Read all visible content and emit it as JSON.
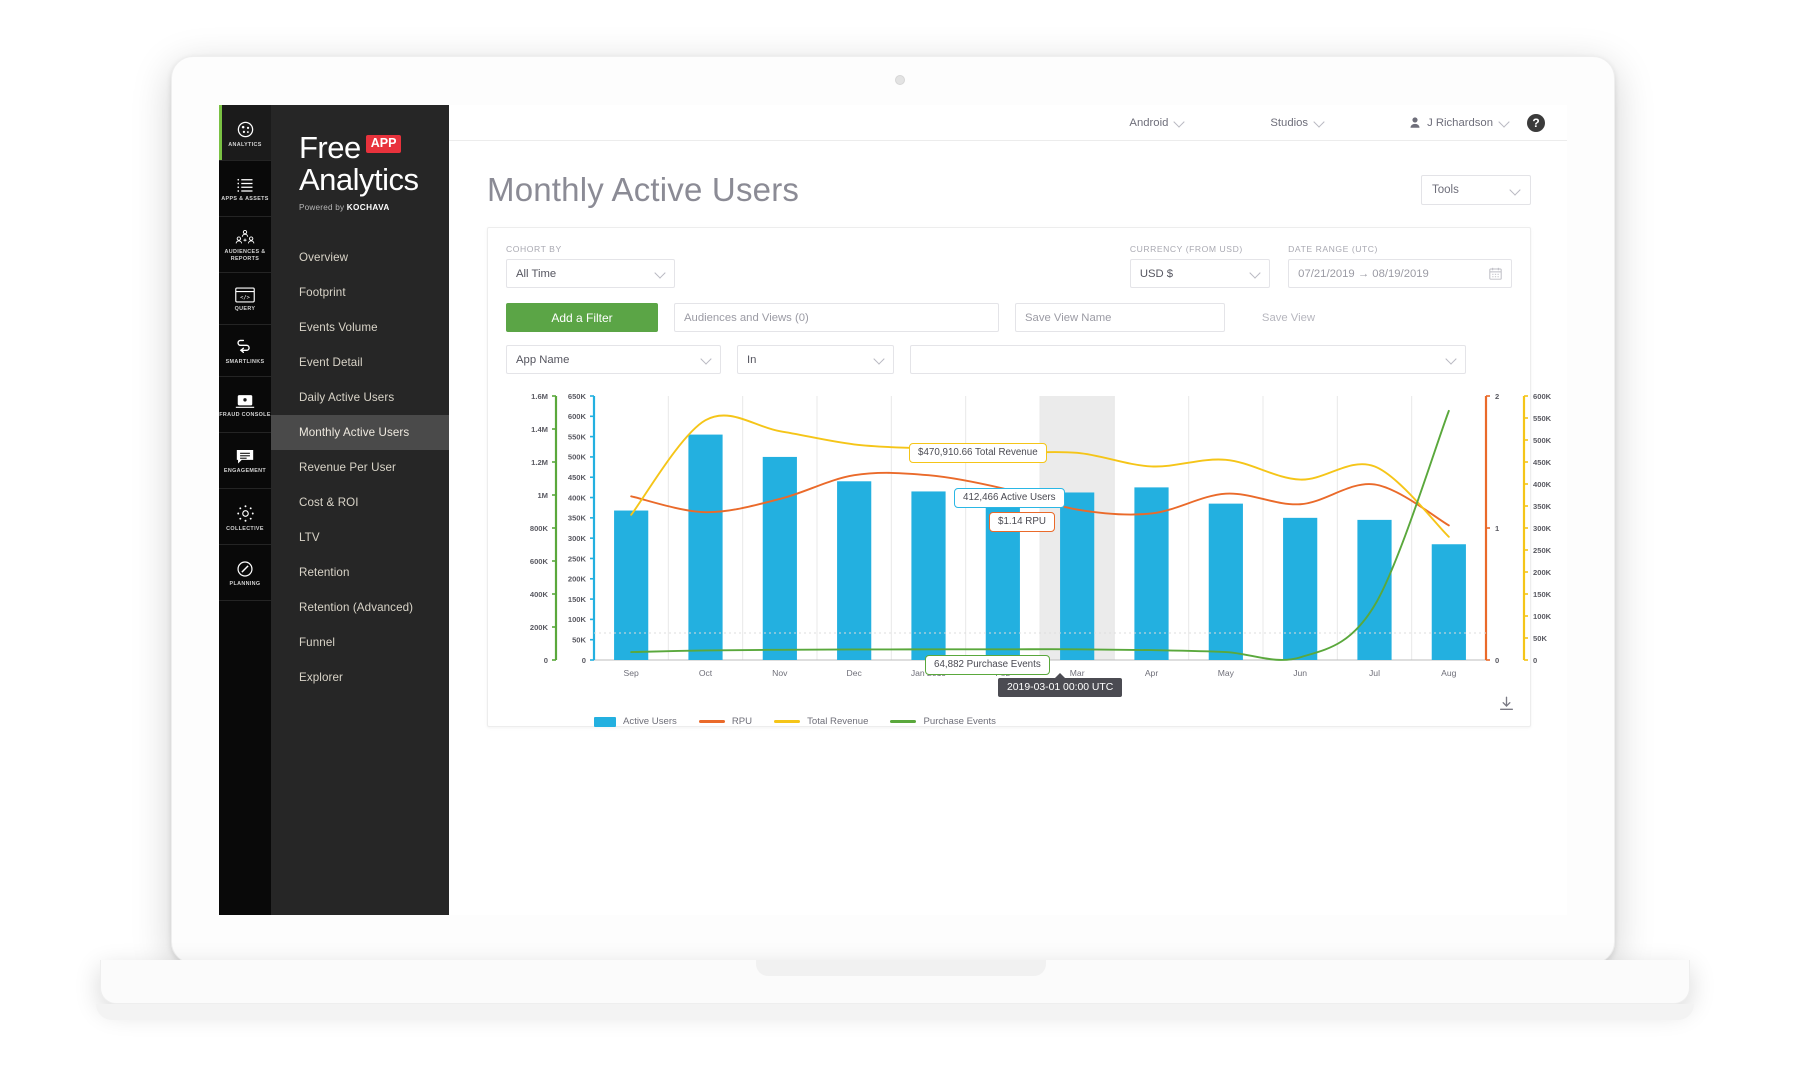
{
  "rail": {
    "items": [
      {
        "id": "analytics",
        "label": "ANALYTICS",
        "icon": "analytics-icon",
        "active": true
      },
      {
        "id": "apps-assets",
        "label": "APPS &\nASSETS",
        "icon": "list-icon",
        "active": false
      },
      {
        "id": "audiences-reports",
        "label": "AUDIENCES &\nREPORTS",
        "icon": "people-icon",
        "active": false
      },
      {
        "id": "query",
        "label": "QUERY",
        "icon": "code-window-icon",
        "active": false
      },
      {
        "id": "smartlinks",
        "label": "SMARTLINKS",
        "icon": "link-path-icon",
        "active": false
      },
      {
        "id": "fraud-console",
        "label": "FRAUD\nCONSOLE",
        "icon": "laptop-icon",
        "active": false
      },
      {
        "id": "engagement",
        "label": "ENGAGEMENT",
        "icon": "message-icon",
        "active": false
      },
      {
        "id": "collective",
        "label": "COLLECTIVE",
        "icon": "gear-dots-icon",
        "active": false
      },
      {
        "id": "planning",
        "label": "PLANNING",
        "icon": "compass-icon",
        "active": false
      }
    ]
  },
  "brand": {
    "word1": "Free",
    "badge": "APP",
    "word2": "Analytics",
    "powered_prefix": "Powered by ",
    "powered_brand": "KOCHAVA"
  },
  "nav": {
    "items": [
      {
        "label": "Overview",
        "active": false
      },
      {
        "label": "Footprint",
        "active": false
      },
      {
        "label": "Events Volume",
        "active": false
      },
      {
        "label": "Event Detail",
        "active": false
      },
      {
        "label": "Daily Active Users",
        "active": false
      },
      {
        "label": "Monthly Active Users",
        "active": true
      },
      {
        "label": "Revenue Per User",
        "active": false
      },
      {
        "label": "Cost & ROI",
        "active": false
      },
      {
        "label": "LTV",
        "active": false
      },
      {
        "label": "Retention",
        "active": false
      },
      {
        "label": "Retention (Advanced)",
        "active": false
      },
      {
        "label": "Funnel",
        "active": false
      },
      {
        "label": "Explorer",
        "active": false
      }
    ]
  },
  "topbar": {
    "platform": "Android",
    "account": "Studios",
    "user": "J Richardson",
    "help": "?"
  },
  "header": {
    "title": "Monthly Active Users",
    "tools_label": "Tools"
  },
  "filters": {
    "cohort_label": "COHORT BY",
    "cohort_value": "All Time",
    "currency_label": "CURRENCY (FROM USD)",
    "currency_value": "USD $",
    "daterange_label": "DATE RANGE (UTC)",
    "daterange_value": "07/21/2019 → 08/19/2019",
    "add_filter": "Add a Filter",
    "audiences_placeholder": "Audiences and Views (0)",
    "save_view_name_placeholder": "Save View Name",
    "save_view_button": "Save View",
    "field_attribute": "App Name",
    "field_operator": "In",
    "field_value": ""
  },
  "chart_data": {
    "type": "bar",
    "title": "Monthly Active Users",
    "xlabel": "",
    "ylabel": "Active Users",
    "categories": [
      "Sep",
      "Oct",
      "Nov",
      "Dec",
      "Jan 2019",
      "Feb",
      "Mar",
      "Apr",
      "May",
      "Jun",
      "Jul",
      "Aug"
    ],
    "axes": {
      "left_outer": {
        "name": "Purchase Events",
        "color": "#5aa83c",
        "ticks": [
          "0",
          "200K",
          "400K",
          "600K",
          "800K",
          "1M",
          "1.2M",
          "1.4M",
          "1.6M"
        ],
        "min": 0,
        "max": 1600000
      },
      "left_inner": {
        "name": "Active Users",
        "color": "#23b0e0",
        "ticks": [
          "0",
          "50K",
          "100K",
          "150K",
          "200K",
          "250K",
          "300K",
          "350K",
          "400K",
          "450K",
          "500K",
          "550K",
          "600K",
          "650K"
        ],
        "min": 0,
        "max": 650000
      },
      "right_inner": {
        "name": "RPU",
        "color": "#ea6a2a",
        "ticks": [
          "0",
          "1",
          "2"
        ],
        "min": 0,
        "max": 2
      },
      "right_outer": {
        "name": "Total Revenue",
        "color": "#f5c518",
        "ticks": [
          "0",
          "50K",
          "100K",
          "150K",
          "200K",
          "250K",
          "300K",
          "350K",
          "400K",
          "450K",
          "500K",
          "550K",
          "600K"
        ],
        "min": 0,
        "max": 600000
      }
    },
    "series": [
      {
        "name": "Active Users",
        "type": "bar",
        "color": "#23b0e0",
        "axis": "left_inner",
        "values": [
          368000,
          555000,
          500000,
          440000,
          415000,
          420000,
          412466,
          425000,
          385000,
          350000,
          345000,
          285000
        ]
      },
      {
        "name": "RPU",
        "type": "line",
        "color": "#ea6a2a",
        "axis": "right_inner",
        "values": [
          1.24,
          1.12,
          1.22,
          1.4,
          1.4,
          1.3,
          1.14,
          1.11,
          1.26,
          1.18,
          1.33,
          1.02
        ]
      },
      {
        "name": "Total Revenue",
        "type": "line",
        "color": "#f5c518",
        "axis": "right_outer",
        "values": [
          330000,
          545000,
          520000,
          490000,
          480000,
          470910.66,
          470910.66,
          440000,
          455000,
          410000,
          440000,
          280000
        ]
      },
      {
        "name": "Purchase Events",
        "type": "line",
        "color": "#5aa83c",
        "axis": "left_outer",
        "values": [
          48000,
          58000,
          62000,
          64000,
          64500,
          64882,
          64882,
          60000,
          48000,
          16000,
          330000,
          1510000
        ]
      }
    ],
    "legend": [
      "Active Users",
      "RPU",
      "Total Revenue",
      "Purchase Events"
    ],
    "legend_position": "bottom",
    "grid": true,
    "highlighted_category": "Mar",
    "callouts": [
      {
        "id": "total-revenue-callout",
        "text": "$470,910.66 Total Revenue",
        "color": "#f5c518"
      },
      {
        "id": "active-users-callout",
        "text": "412,466 Active Users",
        "color": "#2ab7e5"
      },
      {
        "id": "rpu-callout",
        "text": "$1.14 RPU",
        "color": "#ea6a2a"
      },
      {
        "id": "purchase-events-callout",
        "text": "64,882 Purchase Events",
        "color": "#5aa83c"
      }
    ],
    "hover_tooltip": "2019-03-01 00:00 UTC"
  },
  "chart_footer": {
    "download_icon": "download-icon"
  }
}
